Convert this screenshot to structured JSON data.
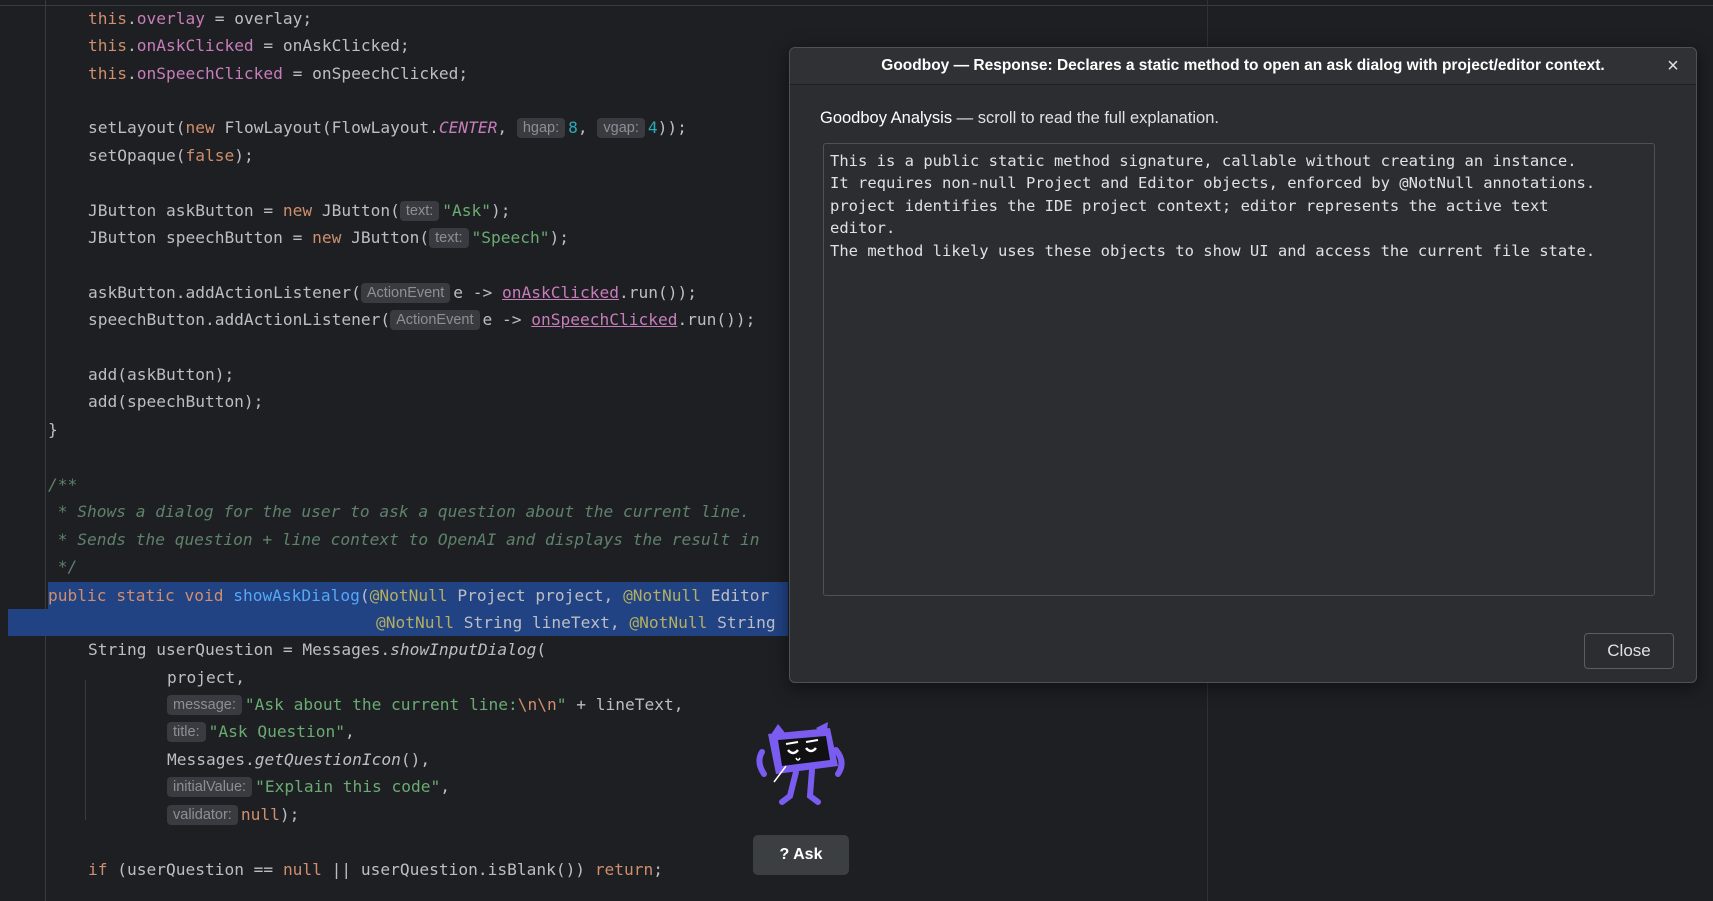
{
  "editor": {
    "lines": {
      "l1": {
        "this": "this",
        "dot": ".",
        "field": "overlay",
        "rest": " = overlay;"
      },
      "l2": {
        "this": "this",
        "dot": ".",
        "field": "onAskClicked",
        "rest": " = onAskClicked;"
      },
      "l3": {
        "this": "this",
        "dot": ".",
        "field": "onSpeechClicked",
        "rest": " = onSpeechClicked;"
      },
      "l5": {
        "a": "setLayout(",
        "new": "new",
        "b": " FlowLayout(FlowLayout.",
        "center": "CENTER",
        "c": ", ",
        "hint1": "hgap:",
        "n1": "8",
        "d": ", ",
        "hint2": "vgap:",
        "n2": "4",
        "e": "));"
      },
      "l6": {
        "a": "setOpaque(",
        "false": "false",
        "b": ");"
      },
      "l8": {
        "a": "JButton askButton = ",
        "new": "new",
        "b": " JButton(",
        "hint": "text:",
        "str": "\"Ask\"",
        "c": ");"
      },
      "l9": {
        "a": "JButton speechButton = ",
        "new": "new",
        "b": " JButton(",
        "hint": "text:",
        "str": "\"Speech\"",
        "c": ");"
      },
      "l11": {
        "a": "askButton.addActionListener(",
        "hint": "ActionEvent",
        "b": "e -> ",
        "field": "onAskClicked",
        "c": ".run());"
      },
      "l12": {
        "a": "speechButton.addActionListener(",
        "hint": "ActionEvent",
        "b": "e -> ",
        "field": "onSpeechClicked",
        "c": ".run());"
      },
      "l14": "add(askButton);",
      "l15": "add(speechButton);",
      "l16": "}",
      "l18": "/**",
      "l19": " * Shows a dialog for the user to ask a question about the current line.",
      "l20": " * Sends the question + line context to OpenAI and displays the result in",
      "l21": " */",
      "l22": {
        "public": "public",
        "static": "static",
        "void": "void",
        "fn": "showAskDialog",
        "p": "(",
        "ann1": "@NotNull",
        "a": " Project project, ",
        "ann2": "@NotNull",
        "b": " Editor"
      },
      "l23": {
        "ann1": "@NotNull",
        "a": " String lineText, ",
        "ann2": "@NotNull",
        "b": " String"
      },
      "l24": {
        "a": "String userQuestion = Messages.",
        "fn": "showInputDialog",
        "b": "("
      },
      "l25": "project,",
      "l26": {
        "hint": "message:",
        "str": "\"Ask about the current line:",
        "esc": "\\n\\n",
        "strEnd": "\"",
        "b": " + lineText,"
      },
      "l27": {
        "hint": "title:",
        "str": "\"Ask Question\"",
        "b": ","
      },
      "l28": {
        "a": "Messages.",
        "fn": "getQuestionIcon",
        "b": "(),"
      },
      "l29": {
        "hint": "initialValue:",
        "str": "\"Explain this code\"",
        "b": ","
      },
      "l30": {
        "hint": "validator:",
        "null": "null",
        "b": ");"
      },
      "l32": {
        "if": "if",
        "a": " (userQuestion == ",
        "null": "null",
        "b": " || userQuestion.isBlank()) ",
        "return": "return",
        "c": ";"
      }
    }
  },
  "dialog": {
    "title": "Goodboy — Response: Declares a static method to open an ask dialog with project/editor context.",
    "subtitle_bold": "Goodboy Analysis",
    "subtitle_rest": " — scroll to read the full explanation.",
    "body": "This is a public static method signature, callable without creating an instance.\nIt requires non-null Project and Editor objects, enforced by @NotNull annotations.\nproject identifies the IDE project context; editor represents the active text\neditor.\nThe method likely uses these objects to show UI and access the current file state.",
    "close_label": "Close",
    "close_icon": "×"
  },
  "ask_button": {
    "label": "? Ask"
  },
  "colors": {
    "keyword": "#cf8e6d",
    "field": "#c77dbb",
    "string": "#6aab73",
    "number": "#2aacb8",
    "function": "#56a8f5",
    "annotation": "#b3ae60",
    "comment": "#5f826b",
    "selection": "#214283",
    "mascot": "#7b5cf0"
  }
}
